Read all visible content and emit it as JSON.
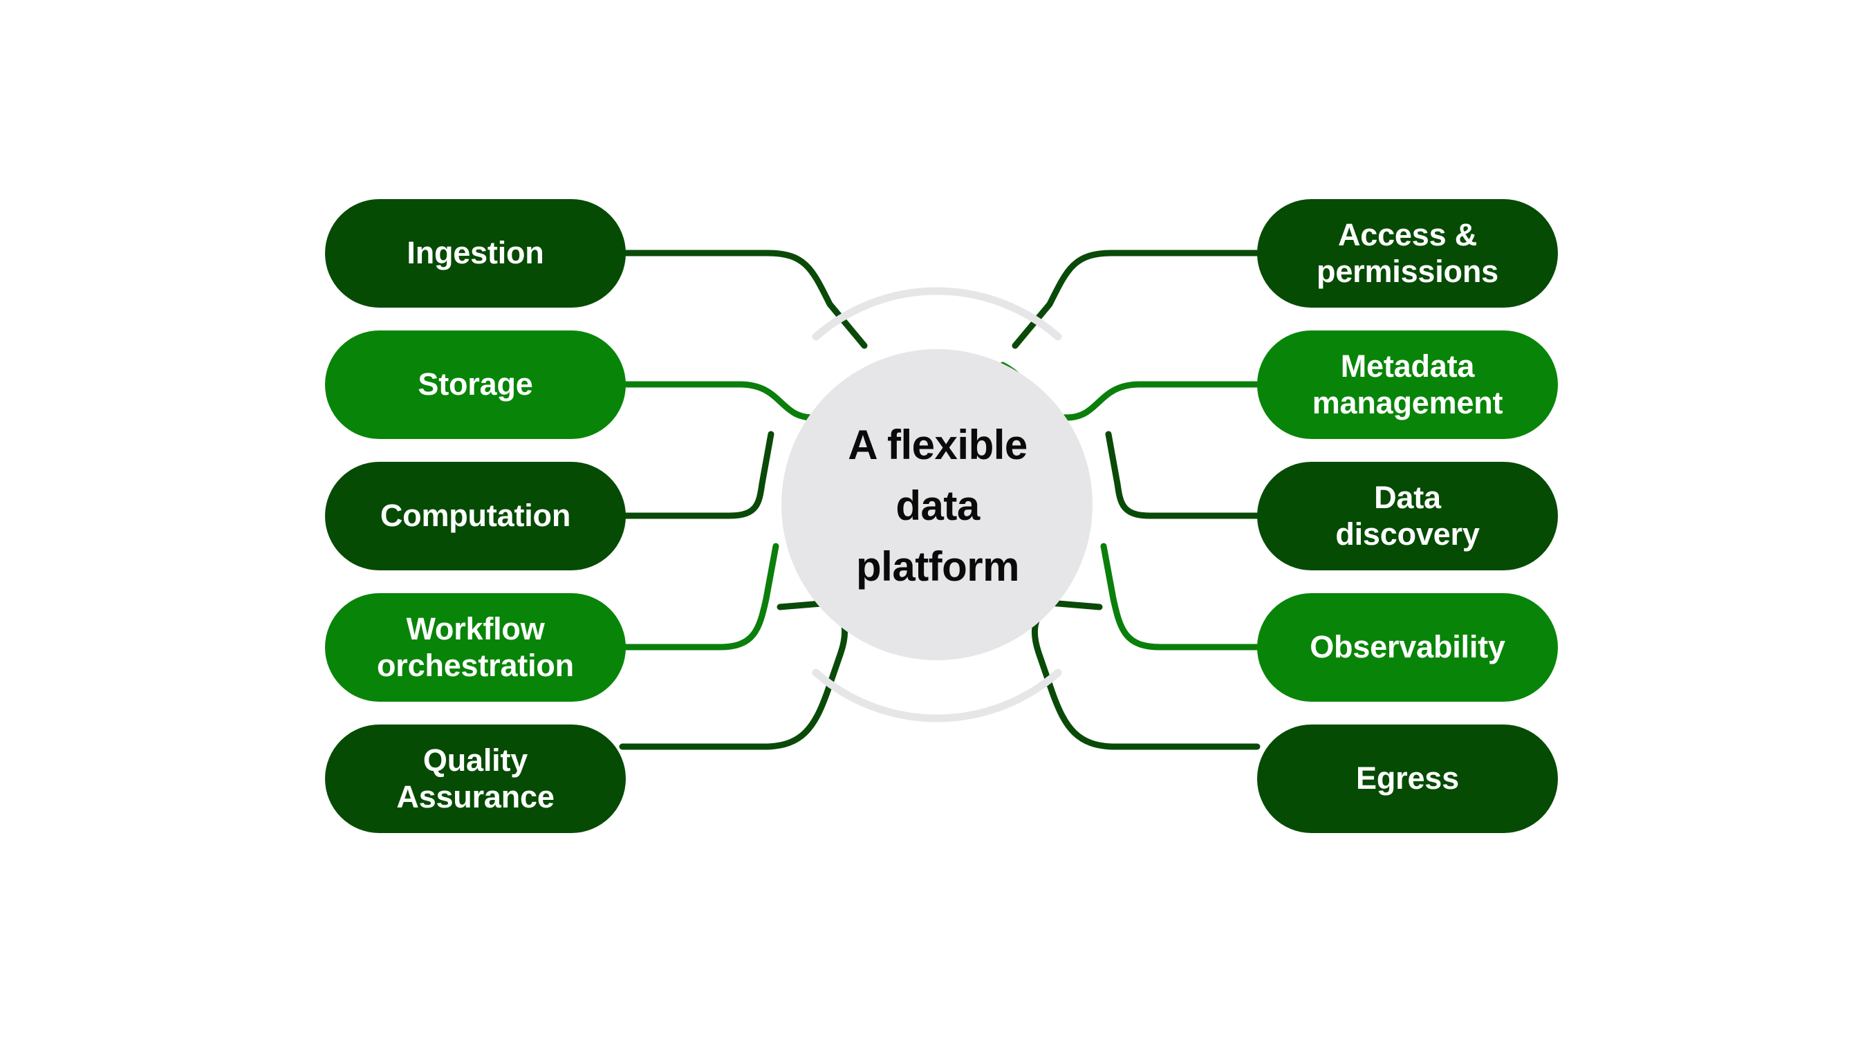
{
  "diagram": {
    "type": "mind-map",
    "title": "A flexible data platform",
    "hub": {
      "label_lines": [
        "A flexible",
        "data",
        "platform"
      ],
      "fill_color": "#e6e6e8",
      "ring_color": "#e6e6e8",
      "text_color": "#0a0a0a"
    },
    "palette": {
      "dark_green": "#064b04",
      "light_green": "#088508",
      "connector_dark": "#0a4a08",
      "connector_light": "#0b7f0b",
      "background": "#ffffff",
      "node_text": "#ffffff"
    },
    "left_nodes": [
      {
        "label": "Ingestion",
        "tone": "dark",
        "row": 0
      },
      {
        "label": "Storage",
        "tone": "light",
        "row": 1
      },
      {
        "label": "Computation",
        "tone": "dark",
        "row": 2
      },
      {
        "label": "Workflow\norchestration",
        "tone": "light",
        "row": 3
      },
      {
        "label": "Quality\nAssurance",
        "tone": "dark",
        "row": 4
      }
    ],
    "right_nodes": [
      {
        "label": "Access &\npermissions",
        "tone": "dark",
        "row": 0
      },
      {
        "label": "Metadata\nmanagement",
        "tone": "light",
        "row": 1
      },
      {
        "label": "Data\ndiscovery",
        "tone": "dark",
        "row": 2
      },
      {
        "label": "Observability",
        "tone": "light",
        "row": 3
      },
      {
        "label": "Egress",
        "tone": "dark",
        "row": 4
      }
    ]
  }
}
